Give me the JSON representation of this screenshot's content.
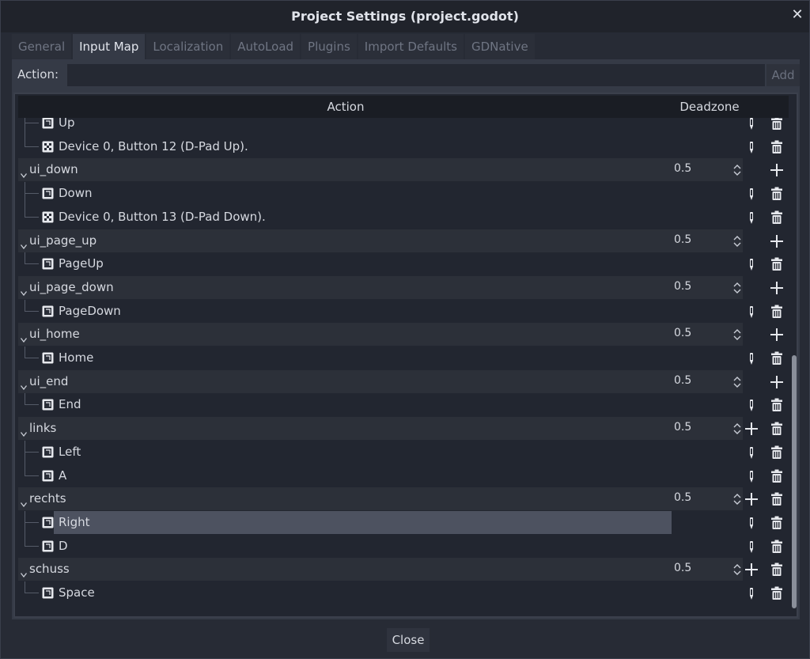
{
  "window": {
    "title": "Project Settings (project.godot)"
  },
  "tabs": [
    "General",
    "Input Map",
    "Localization",
    "AutoLoad",
    "Plugins",
    "Import Defaults",
    "GDNative"
  ],
  "action_bar": {
    "label": "Action:",
    "value": "",
    "add_label": "Add"
  },
  "tree": {
    "headers": {
      "action": "Action",
      "deadzone": "Deadzone"
    },
    "rows": [
      {
        "kind": "event",
        "icon": "keyboard",
        "label": "Up"
      },
      {
        "kind": "event",
        "icon": "joypad",
        "label": "Device 0, Button 12 (D-Pad Up)."
      },
      {
        "kind": "group",
        "label": "ui_down",
        "deadzone": "0.5",
        "removable": false
      },
      {
        "kind": "event",
        "icon": "keyboard",
        "label": "Down"
      },
      {
        "kind": "event",
        "icon": "joypad",
        "label": "Device 0, Button 13 (D-Pad Down)."
      },
      {
        "kind": "group",
        "label": "ui_page_up",
        "deadzone": "0.5",
        "removable": false
      },
      {
        "kind": "event",
        "icon": "keyboard",
        "label": "PageUp"
      },
      {
        "kind": "group",
        "label": "ui_page_down",
        "deadzone": "0.5",
        "removable": false
      },
      {
        "kind": "event",
        "icon": "keyboard",
        "label": "PageDown"
      },
      {
        "kind": "group",
        "label": "ui_home",
        "deadzone": "0.5",
        "removable": false
      },
      {
        "kind": "event",
        "icon": "keyboard",
        "label": "Home"
      },
      {
        "kind": "group",
        "label": "ui_end",
        "deadzone": "0.5",
        "removable": false
      },
      {
        "kind": "event",
        "icon": "keyboard",
        "label": "End"
      },
      {
        "kind": "group",
        "label": "links",
        "deadzone": "0.5",
        "removable": true
      },
      {
        "kind": "event",
        "icon": "keyboard",
        "label": "Left"
      },
      {
        "kind": "event",
        "icon": "keyboard",
        "label": "A"
      },
      {
        "kind": "group",
        "label": "rechts",
        "deadzone": "0.5",
        "removable": true
      },
      {
        "kind": "event",
        "icon": "keyboard",
        "label": "Right",
        "selected": true
      },
      {
        "kind": "event",
        "icon": "keyboard",
        "label": "D"
      },
      {
        "kind": "group",
        "label": "schuss",
        "deadzone": "0.5",
        "removable": true
      },
      {
        "kind": "event",
        "icon": "keyboard",
        "label": "Space"
      }
    ]
  },
  "footer": {
    "close_label": "Close"
  },
  "icons": {
    "close": "close-icon",
    "expand": "chevron-down-icon",
    "keyboard": "keyboard-icon",
    "joypad": "joypad-icon",
    "spin": "spin-updown-icon",
    "add": "plus-icon",
    "edit": "edit-icon",
    "remove": "trash-icon"
  },
  "colors": {
    "panel": "#353a46",
    "tree_bg": "#222630",
    "group_row": "#2c3039",
    "selected": "#4d5260"
  }
}
